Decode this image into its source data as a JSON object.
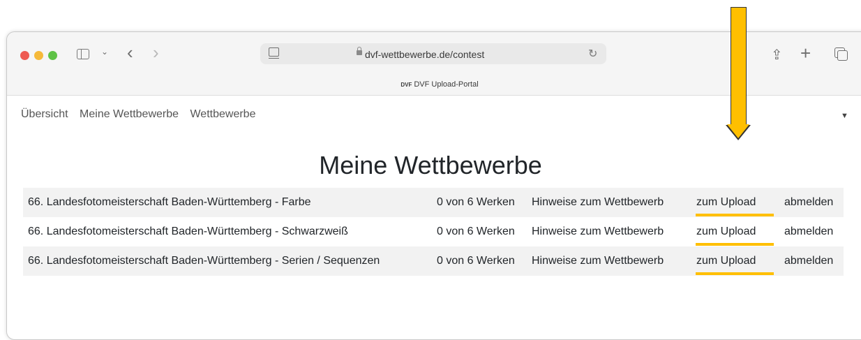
{
  "browser": {
    "url": "dvf-wettbewerbe.de/contest",
    "tab_title": "DVF Upload-Portal",
    "favicon_text": "DVF",
    "icons": [
      "sidebar-icon",
      "chevron-down-icon",
      "back-icon",
      "forward-icon",
      "page-icon",
      "lock-icon",
      "reload-icon",
      "share-icon",
      "plus-icon",
      "tabs-icon"
    ]
  },
  "nav": {
    "items": [
      "Übersicht",
      "Meine Wettbewerbe",
      "Wettbewerbe"
    ]
  },
  "page": {
    "title": "Meine Wettbewerbe"
  },
  "contests": [
    {
      "name": "66. Landesfotomeisterschaft Baden-Württemberg - Farbe",
      "count": "0 von 6 Werken",
      "hint": "Hinweise zum Wettbewerb",
      "upload": "zum Upload",
      "unsubscribe": "abmelden"
    },
    {
      "name": "66. Landesfotomeisterschaft Baden-Württemberg - Schwarzweiß",
      "count": "0 von 6 Werken",
      "hint": "Hinweise zum Wettbewerb",
      "upload": "zum Upload",
      "unsubscribe": "abmelden"
    },
    {
      "name": "66. Landesfotomeisterschaft Baden-Württemberg - Serien / Sequenzen",
      "count": "0 von 6 Werken",
      "hint": "Hinweise zum Wettbewerb",
      "upload": "zum Upload",
      "unsubscribe": "abmelden"
    }
  ],
  "colors": {
    "accent": "#ffbf00"
  }
}
